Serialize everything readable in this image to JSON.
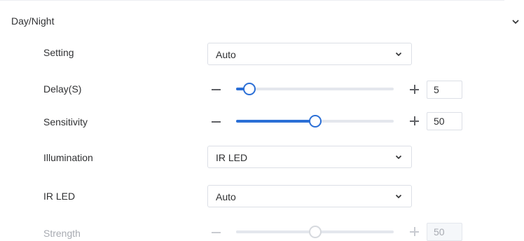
{
  "section": {
    "title": "Day/Night",
    "collapse_icon": "chevron-down-icon"
  },
  "setting": {
    "label": "Setting",
    "value": "Auto",
    "icon": "chevron-down-icon"
  },
  "delay": {
    "label": "Delay(S)",
    "value": "5",
    "min": 0,
    "max": 60,
    "minus_icon": "minus-icon",
    "plus_icon": "plus-icon"
  },
  "sensitivity": {
    "label": "Sensitivity",
    "value": "50",
    "min": 0,
    "max": 100,
    "minus_icon": "minus-icon",
    "plus_icon": "plus-icon"
  },
  "illumination": {
    "label": "Illumination",
    "value": "IR LED",
    "icon": "chevron-down-icon"
  },
  "ir_led": {
    "label": "IR LED",
    "value": "Auto",
    "icon": "chevron-down-icon"
  },
  "strength": {
    "label": "Strength",
    "value": "50",
    "min": 0,
    "max": 100,
    "disabled": true,
    "minus_icon": "minus-icon",
    "plus_icon": "plus-icon"
  },
  "colors": {
    "accent": "#2b6fd6",
    "track": "#e4e7ed",
    "text": "#303133",
    "disabled_text": "#a8abb2"
  }
}
